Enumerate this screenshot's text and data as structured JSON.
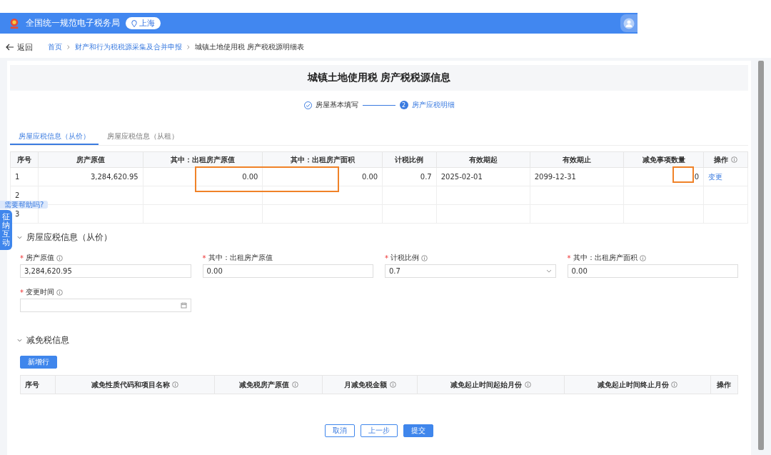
{
  "header": {
    "site_title": "全国统一规范电子税务局",
    "region": "上海"
  },
  "breadcrumb": {
    "back": "返回",
    "items": [
      "首页",
      "财产和行为税税源采集及合并申报",
      "城镇土地使用税 房产税税源明细表"
    ]
  },
  "page_title": "城镇土地使用税 房产税税源信息",
  "steps": [
    {
      "label": "房屋基本填写",
      "completed": true
    },
    {
      "label": "房产应税明细",
      "completed": false,
      "number": "2"
    }
  ],
  "tabs": [
    {
      "label": "房屋应税信息（从价）",
      "selected": true
    },
    {
      "label": "房屋应税信息（从租）",
      "selected": false
    }
  ],
  "table": {
    "columns": [
      {
        "label": "序号"
      },
      {
        "label": "房产原值"
      },
      {
        "label": "其中：出租房产原值"
      },
      {
        "label": "其中：出租房产面积"
      },
      {
        "label": "计税比例"
      },
      {
        "label": "有效期起"
      },
      {
        "label": "有效期止"
      },
      {
        "label": "减免事项数量"
      },
      {
        "label": "操作",
        "info": true
      }
    ],
    "rows": [
      {
        "cells": [
          "1",
          "3,284,620.95",
          "0.00",
          "0.00",
          "0.7",
          "2025-02-01",
          "2099-12-31",
          "0"
        ],
        "action": "变更"
      },
      {
        "cells": [
          "2"
        ]
      },
      {
        "cells": [
          "3"
        ]
      }
    ]
  },
  "help_tooltip": "需要帮助吗?",
  "side_tab": "征纳互动",
  "section_taxable": {
    "title": "房屋应税信息（从价）",
    "fields": [
      {
        "label": "房产原值",
        "kind": "text",
        "required_mark": "*",
        "info": true,
        "value": "3,284,620.95"
      },
      {
        "label": "其中：出租房产原值",
        "kind": "text",
        "required_mark": "*",
        "value": "0.00"
      },
      {
        "label": "计税比例",
        "kind": "select",
        "required_mark": "*",
        "info": true,
        "value": "0.7"
      },
      {
        "label": "其中：出租房产面积",
        "kind": "text",
        "required_mark": "*",
        "info": true,
        "value": "0.00"
      },
      {
        "label": "变更时间",
        "kind": "date",
        "required_mark": "*",
        "info": true
      }
    ]
  },
  "section_relief": {
    "title": "减免税信息",
    "add_button": "新增行",
    "columns": [
      {
        "label": "序号"
      },
      {
        "label": "减免性质代码和项目名称",
        "info": true
      },
      {
        "label": "减免税房产原值",
        "info": true
      },
      {
        "label": "月减免税金额",
        "info": true
      },
      {
        "label": "减免起止时间起始月份",
        "info": true
      },
      {
        "label": "减免起止时间终止月份",
        "info": true
      },
      {
        "label": "操作"
      }
    ]
  },
  "footer_buttons": [
    {
      "label": "取消",
      "primary": false
    },
    {
      "label": "上一步",
      "primary": false
    },
    {
      "label": "提交",
      "primary": true
    }
  ]
}
